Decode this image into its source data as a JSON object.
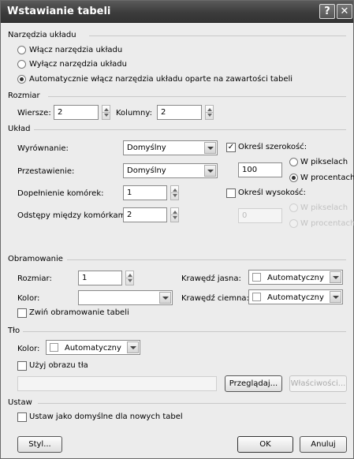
{
  "title": "Wstawianie tabeli",
  "help_button": "?",
  "close_button": "✕",
  "layout_tools": {
    "title": "Narzędzia układu",
    "options": [
      "Włącz narzędzia układu",
      "Wyłącz narzędzia układu",
      "Automatycznie włącz narzędzia układu oparte na zawartości tabeli"
    ],
    "selected_index": 2
  },
  "size": {
    "title": "Rozmiar",
    "rows_label": "Wiersze:",
    "rows_value": "2",
    "columns_label": "Kolumny:",
    "columns_value": "2"
  },
  "layout": {
    "title": "Układ",
    "alignment_label": "Wyrównanie:",
    "alignment_value": "Domyślny",
    "float_label": "Przestawienie:",
    "float_value": "Domyślny",
    "padding_label": "Dopełnienie komórek:",
    "padding_value": "1",
    "spacing_label": "Odstępy między komórkami:",
    "spacing_value": "2",
    "width_check_label": "Określ szerokość:",
    "width_checked": true,
    "width_value": "100",
    "width_unit_pixels": "W pikselach",
    "width_unit_percent": "W procentach",
    "width_unit_selected": "percent",
    "height_check_label": "Określ wysokość:",
    "height_checked": false,
    "height_value": "0",
    "height_unit_pixels": "W pikselach",
    "height_unit_percent": "W procentach"
  },
  "borders": {
    "title": "Obramowanie",
    "size_label": "Rozmiar:",
    "size_value": "1",
    "color_label": "Kolor:",
    "color_value": "",
    "light_label": "Krawędź jasna:",
    "light_value": "Automatyczny",
    "dark_label": "Krawędź ciemna:",
    "dark_value": "Automatyczny",
    "collapse_label": "Zwiń obramowanie tabeli",
    "collapse_checked": false
  },
  "background": {
    "title": "Tło",
    "color_label": "Kolor:",
    "color_value": "Automatyczny",
    "use_image_label": "Użyj obrazu tła",
    "use_image_checked": false,
    "image_path": "",
    "browse_label": "Przeglądaj...",
    "properties_label": "Właściwości..."
  },
  "set": {
    "title": "Ustaw",
    "default_label": "Ustaw jako domyślne dla nowych tabel",
    "default_checked": false
  },
  "footer": {
    "style_label": "Styl...",
    "ok_label": "OK",
    "cancel_label": "Anuluj"
  },
  "colors": {
    "title_bar": "#3f3f3f",
    "dialog_background": "#ececec",
    "disabled_text": "#c2c2c2"
  }
}
